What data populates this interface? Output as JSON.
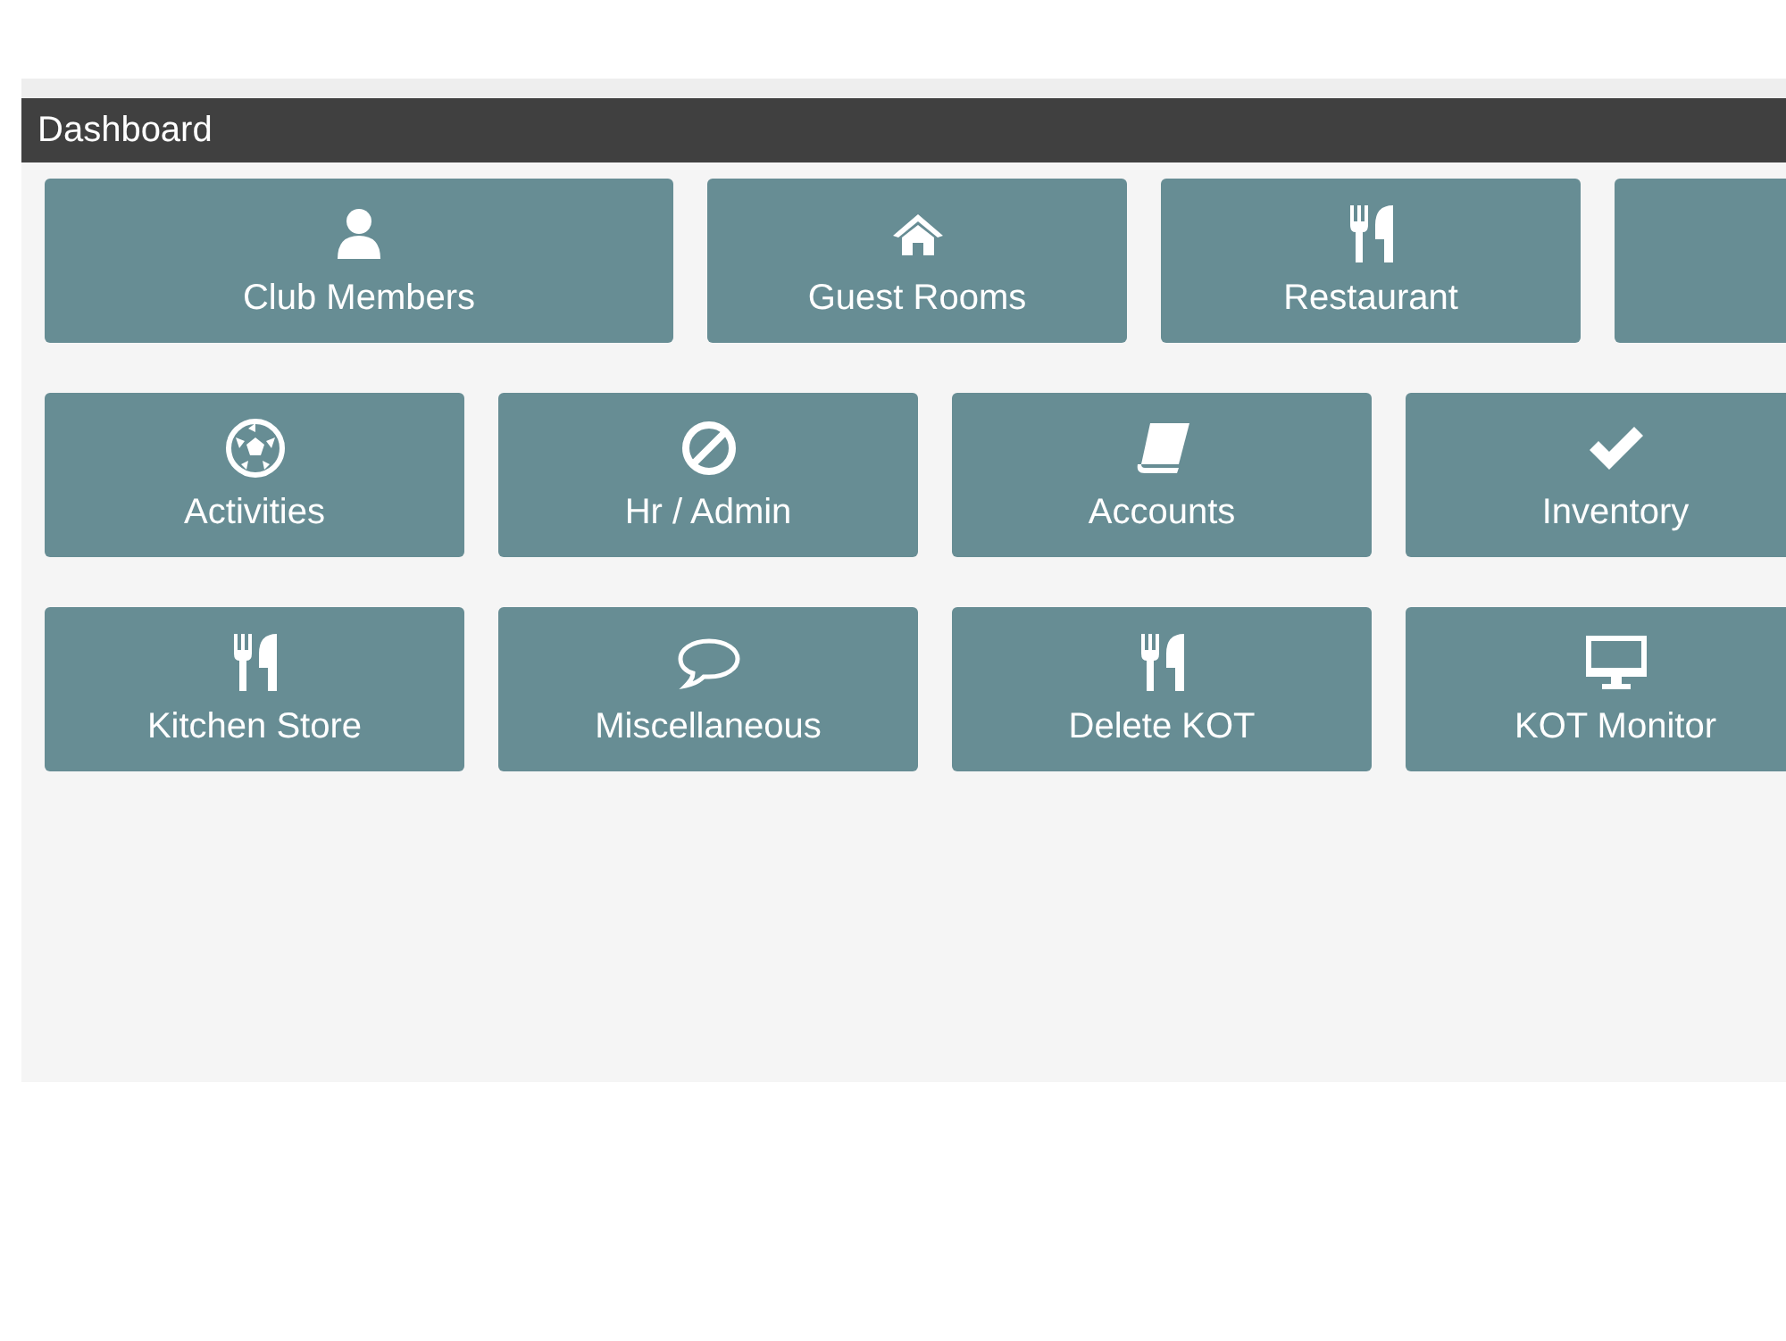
{
  "panel": {
    "title": "Dashboard"
  },
  "rows": [
    {
      "tiles": [
        {
          "kind": "person",
          "label": "Club Members",
          "wide": true
        },
        {
          "kind": "house",
          "label": "Guest Rooms",
          "wide": false
        },
        {
          "kind": "cutlery",
          "label": "Restaurant",
          "wide": false
        },
        {
          "kind": "blank",
          "wide": false
        }
      ]
    },
    {
      "tiles": [
        {
          "kind": "ball",
          "label": "Activities",
          "wide": false
        },
        {
          "kind": "ban",
          "label": "Hr / Admin",
          "wide": false
        },
        {
          "kind": "book",
          "label": "Accounts",
          "wide": false
        },
        {
          "kind": "check",
          "label": "Inventory",
          "wide": false
        }
      ]
    },
    {
      "tiles": [
        {
          "kind": "cutlery",
          "label": "Kitchen Store",
          "wide": false
        },
        {
          "kind": "comment",
          "label": "Miscellaneous",
          "wide": false
        },
        {
          "kind": "cutlery",
          "label": "Delete KOT",
          "wide": false
        },
        {
          "kind": "monitor",
          "label": "KOT Monitor",
          "wide": false
        }
      ]
    }
  ]
}
